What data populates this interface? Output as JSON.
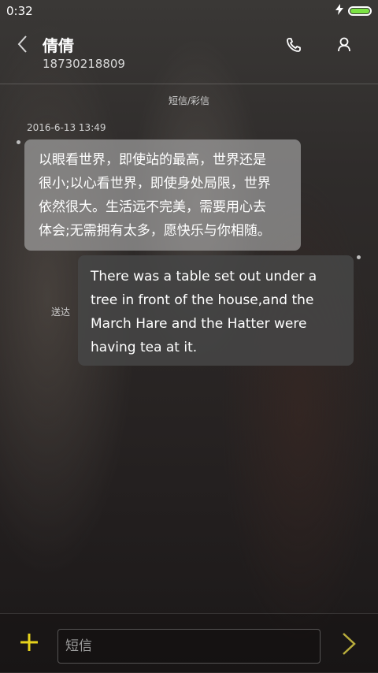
{
  "status_bar": {
    "time": "0:32",
    "battery_level": 1.0
  },
  "header": {
    "contact_name": "倩倩",
    "phone_number": "18730218809"
  },
  "thread": {
    "type_label": "短信/彩信",
    "timestamp": "2016-6-13 13:49",
    "messages": [
      {
        "direction": "incoming",
        "lines": [
          "以眼看世界，即使站的最高，世界还是",
          "很小;以心看世界，即使身处局限，世界",
          "依然很大。生活远不完美，需要用心去",
          "体会;无需拥有太多，愿快乐与你相随。"
        ]
      },
      {
        "direction": "outgoing",
        "lines": [
          "There was a table set out under a",
          "tree in front of the house,and the",
          "March Hare and the Hatter were",
          "having tea at it."
        ],
        "status": "送达"
      }
    ]
  },
  "composer": {
    "placeholder": "短信"
  },
  "colors": {
    "accent": "#e7d31c",
    "battery": "#7be244"
  },
  "icons": [
    "back-arrow-icon",
    "phone-icon",
    "person-icon",
    "charging-icon",
    "plus-icon",
    "send-chevron-icon"
  ]
}
